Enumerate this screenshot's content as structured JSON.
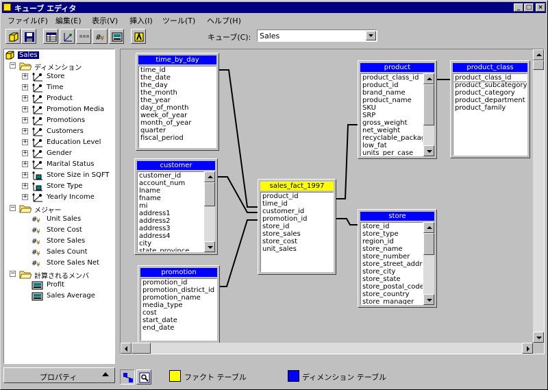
{
  "window": {
    "title": "キューブ エディタ",
    "controls": [
      "_",
      "□",
      "×"
    ]
  },
  "menu": [
    "ファイル(F)",
    "編集(E)",
    "表示(V)",
    "挿入(I)",
    "ツール(T)",
    "ヘルプ(H)"
  ],
  "toolbar": {
    "cube_label": "キューブ(C):",
    "cube_value": "Sales"
  },
  "tree": {
    "root": "Sales",
    "dimensions_label": "ディメンション",
    "dimensions": [
      "Store",
      "Time",
      "Product",
      "Promotion Media",
      "Promotions",
      "Customers",
      "Education Level",
      "Gender",
      "Marital Status",
      "Store Size in SQFT",
      "Store Type",
      "Yearly Income"
    ],
    "measures_label": "メジャー",
    "measures": [
      "Unit Sales",
      "Store Cost",
      "Store Sales",
      "Sales Count",
      "Store Sales Net"
    ],
    "calc_label": "計算されるメンバ",
    "calculated": [
      "Profit",
      "Sales Average"
    ]
  },
  "properties_button": "プロパティ",
  "tables": {
    "time_by_day": {
      "name": "time_by_day",
      "fields": [
        "time_id",
        "the_date",
        "the_day",
        "the_month",
        "the_year",
        "day_of_month",
        "week_of_year",
        "month_of_year",
        "quarter",
        "fiscal_period"
      ]
    },
    "customer": {
      "name": "customer",
      "fields": [
        "customer_id",
        "account_num",
        "lname",
        "fname",
        "mi",
        "address1",
        "address2",
        "address3",
        "address4",
        "city",
        "state_province"
      ]
    },
    "promotion": {
      "name": "promotion",
      "fields": [
        "promotion_id",
        "promotion_district_id",
        "promotion_name",
        "media_type",
        "cost",
        "start_date",
        "end_date"
      ]
    },
    "sales_fact_1997": {
      "name": "sales_fact_1997",
      "fields": [
        "product_id",
        "time_id",
        "customer_id",
        "promotion_id",
        "store_id",
        "store_sales",
        "store_cost",
        "unit_sales"
      ]
    },
    "product": {
      "name": "product",
      "fields": [
        "product_class_id",
        "product_id",
        "brand_name",
        "product_name",
        "SKU",
        "SRP",
        "gross_weight",
        "net_weight",
        "recyclable_package",
        "low_fat",
        "units_per_case"
      ]
    },
    "product_class": {
      "name": "product_class",
      "fields": [
        "product_class_id",
        "product_subcategory",
        "product_category",
        "product_department",
        "product_family"
      ]
    },
    "store": {
      "name": "store",
      "fields": [
        "store_id",
        "store_type",
        "region_id",
        "store_name",
        "store_number",
        "store_street_address",
        "store_city",
        "store_state",
        "store_postal_code",
        "store_country",
        "store_manager"
      ]
    }
  },
  "legend": {
    "fact": "ファクト テーブル",
    "fact_color": "#ffff00",
    "dim": "ディメンション テーブル",
    "dim_color": "#0000ff"
  }
}
